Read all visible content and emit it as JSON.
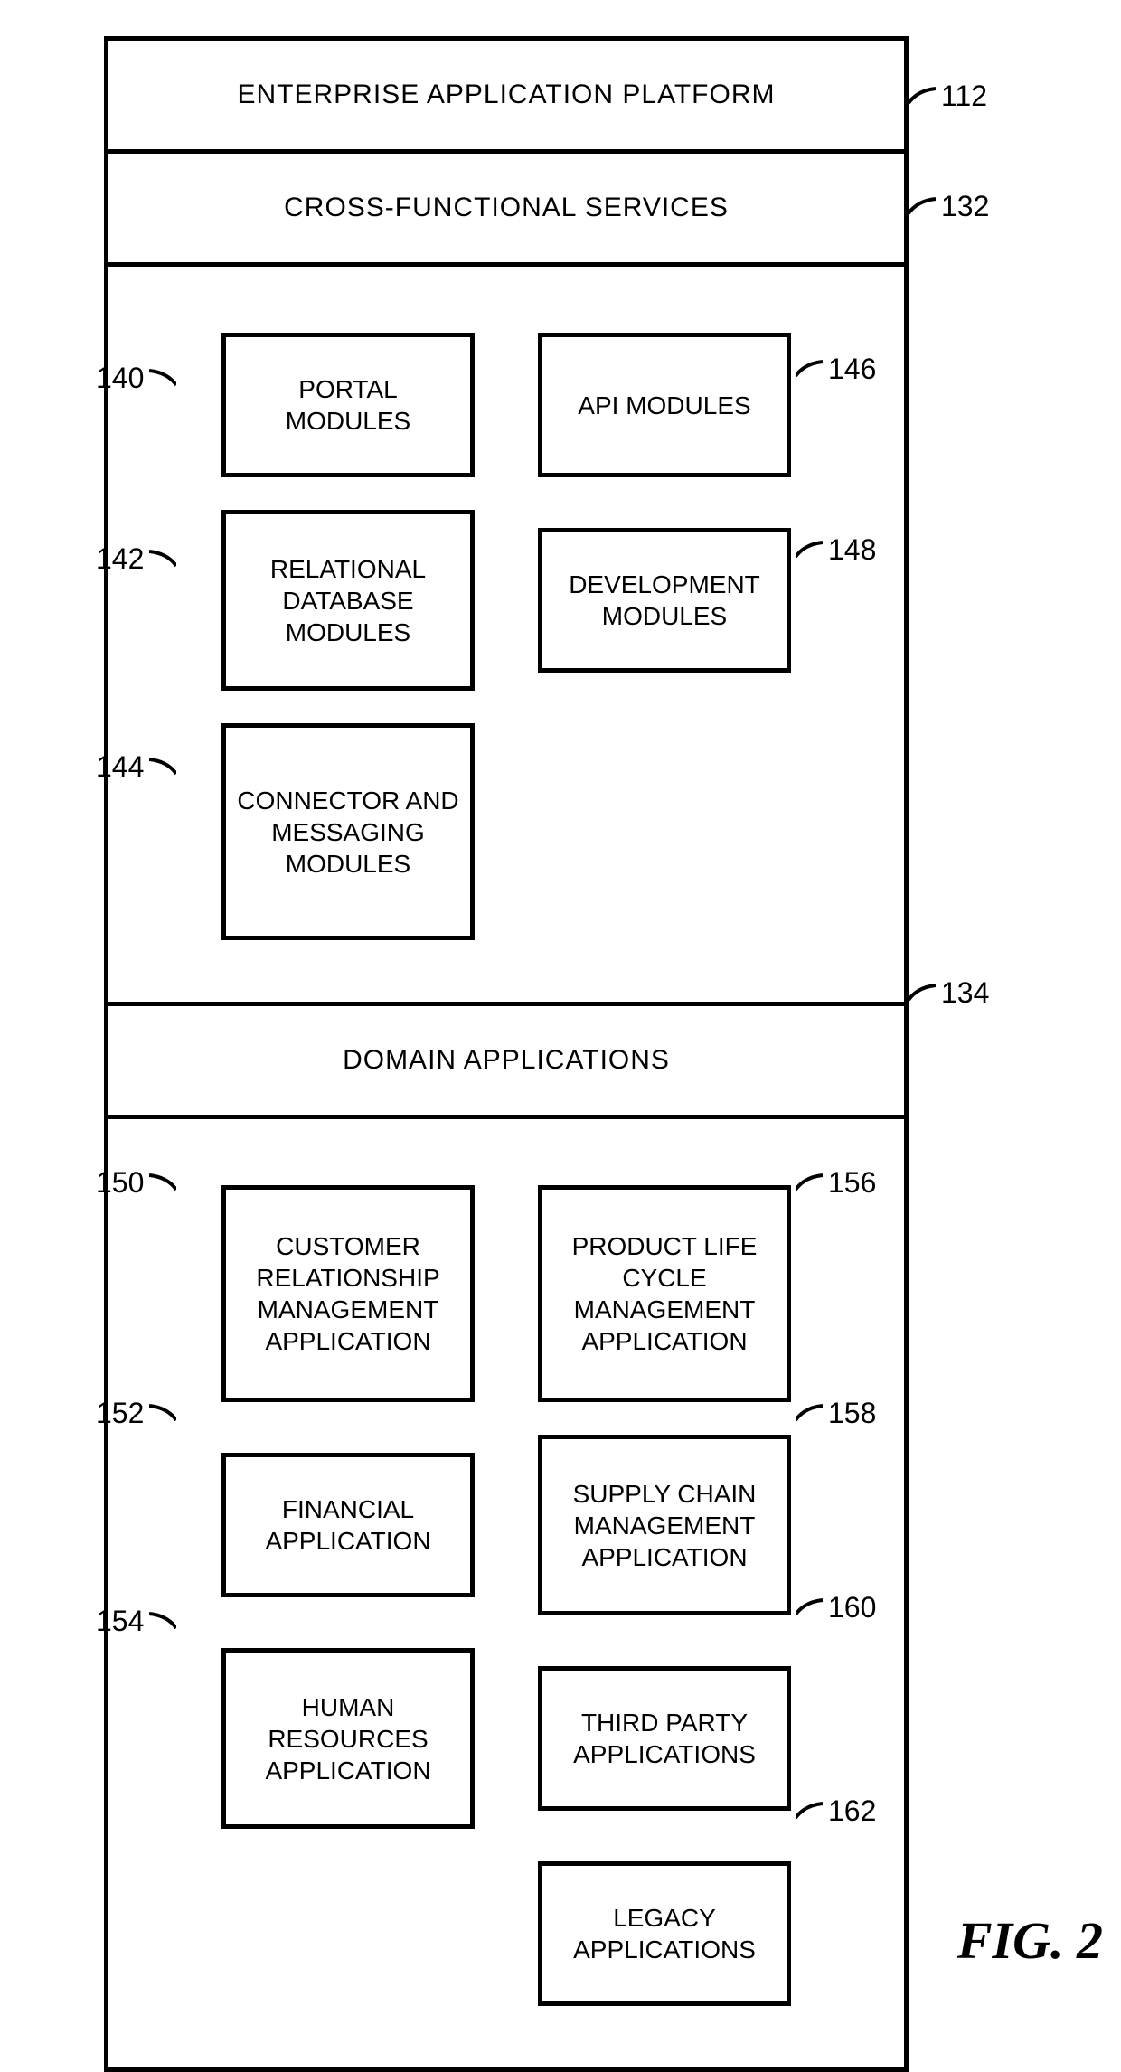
{
  "title": "ENTERPRISE APPLICATION PLATFORM",
  "sections": {
    "cross": {
      "title": "CROSS-FUNCTIONAL SERVICES",
      "boxes": {
        "portal": "PORTAL MODULES",
        "api": "API MODULES",
        "rdb": "RELATIONAL DATABASE MODULES",
        "dev": "DEVELOPMENT MODULES",
        "conn": "CONNECTOR AND MESSAGING MODULES"
      }
    },
    "domain": {
      "title": "DOMAIN APPLICATIONS",
      "boxes": {
        "crm": "CUSTOMER RELATIONSHIP MANAGEMENT APPLICATION",
        "plm": "PRODUCT LIFE CYCLE MANAGEMENT APPLICATION",
        "fin": "FINANCIAL APPLICATION",
        "scm": "SUPPLY CHAIN MANAGEMENT APPLICATION",
        "hr": "HUMAN RESOURCES APPLICATION",
        "tp": "THIRD PARTY APPLICATIONS",
        "legacy": "LEGACY APPLICATIONS"
      }
    }
  },
  "refs": {
    "r112": "112",
    "r132": "132",
    "r134": "134",
    "r140": "140",
    "r142": "142",
    "r144": "144",
    "r146": "146",
    "r148": "148",
    "r150": "150",
    "r152": "152",
    "r154": "154",
    "r156": "156",
    "r158": "158",
    "r160": "160",
    "r162": "162"
  },
  "figure_caption": "FIG. 2"
}
